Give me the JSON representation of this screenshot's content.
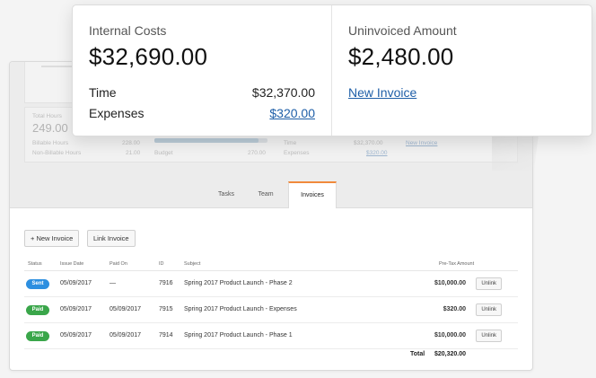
{
  "callout": {
    "internal_costs": {
      "label": "Internal Costs",
      "amount": "$32,690.00",
      "time_label": "Time",
      "time_value": "$32,370.00",
      "expenses_label": "Expenses",
      "expenses_value": "$320.00"
    },
    "uninvoiced": {
      "label": "Uninvoiced Amount",
      "amount": "$2,480.00",
      "new_invoice_link": "New Invoice"
    }
  },
  "stats": {
    "total_hours_label": "Total Hours",
    "total_hours_value": "249.00",
    "billable_label": "Billable Hours",
    "billable_value": "228.00",
    "non_billable_label": "Non-Billable Hours",
    "non_billable_value": "21.00",
    "budget_label": "Budget",
    "budget_value": "270.00",
    "budget_progress": 0.92,
    "time_label": "Time",
    "time_value": "$32,370.00",
    "expenses_label": "Expenses",
    "expenses_value": "$320.00",
    "new_invoice_link": "New Invoice"
  },
  "tabs": [
    "Tasks",
    "Team",
    "Invoices"
  ],
  "active_tab": "Invoices",
  "toolbar": {
    "new_invoice": "+ New Invoice",
    "link_invoice": "Link Invoice"
  },
  "table": {
    "headers": [
      "Status",
      "Issue Date",
      "Paid On",
      "ID",
      "Subject",
      "Pre-Tax Amount"
    ],
    "rows": [
      {
        "status": "Sent",
        "status_color": "#2d8fe0",
        "issue_date": "05/09/2017",
        "paid_on": "—",
        "id": "7916",
        "subject": "Spring 2017 Product Launch - Phase 2",
        "amount": "$10,000.00",
        "action": "Unlink"
      },
      {
        "status": "Paid",
        "status_color": "#3aa64a",
        "issue_date": "05/09/2017",
        "paid_on": "05/09/2017",
        "id": "7915",
        "subject": "Spring 2017 Product Launch - Expenses",
        "amount": "$320.00",
        "action": "Unlink"
      },
      {
        "status": "Paid",
        "status_color": "#3aa64a",
        "issue_date": "05/09/2017",
        "paid_on": "05/09/2017",
        "id": "7914",
        "subject": "Spring 2017 Product Launch - Phase 1",
        "amount": "$10,000.00",
        "action": "Unlink"
      }
    ],
    "total_label": "Total",
    "total_value": "$20,320.00"
  },
  "colors": {
    "accent_tab": "#f08a3c",
    "link": "#1f5fa8"
  }
}
